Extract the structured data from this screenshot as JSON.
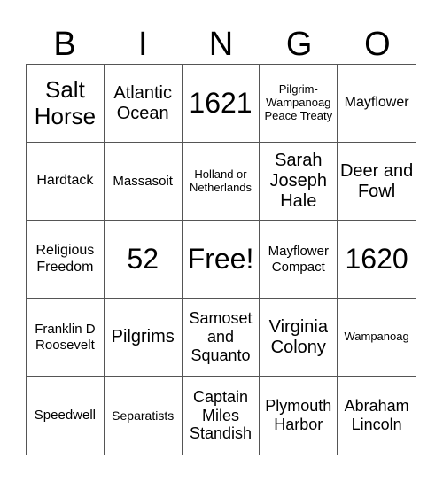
{
  "header": [
    "B",
    "I",
    "N",
    "G",
    "O"
  ],
  "cells": [
    {
      "text": "Salt Horse",
      "size": "s26"
    },
    {
      "text": "Atlantic Ocean",
      "size": "s20"
    },
    {
      "text": "1621",
      "size": "s32"
    },
    {
      "text": "Pilgrim-Wampanoag Peace Treaty",
      "size": "s13"
    },
    {
      "text": "Mayflower",
      "size": "s16"
    },
    {
      "text": "Hardtack",
      "size": "s16"
    },
    {
      "text": "Massasoit",
      "size": "s15"
    },
    {
      "text": "Holland or Netherlands",
      "size": "s13"
    },
    {
      "text": "Sarah Joseph Hale",
      "size": "s20"
    },
    {
      "text": "Deer and Fowl",
      "size": "s20"
    },
    {
      "text": "Religious Freedom",
      "size": "s16"
    },
    {
      "text": "52",
      "size": "s32"
    },
    {
      "text": "Free!",
      "size": "s32"
    },
    {
      "text": "Mayflower Compact",
      "size": "s15"
    },
    {
      "text": "1620",
      "size": "s32"
    },
    {
      "text": "Franklin D Roosevelt",
      "size": "s15"
    },
    {
      "text": "Pilgrims",
      "size": "s20"
    },
    {
      "text": "Samoset and Squanto",
      "size": "s18"
    },
    {
      "text": "Virginia Colony",
      "size": "s20"
    },
    {
      "text": "Wampanoag",
      "size": "s13"
    },
    {
      "text": "Speedwell",
      "size": "s15"
    },
    {
      "text": "Separatists",
      "size": "s14"
    },
    {
      "text": "Captain Miles Standish",
      "size": "s18"
    },
    {
      "text": "Plymouth Harbor",
      "size": "s18"
    },
    {
      "text": "Abraham Lincoln",
      "size": "s18"
    }
  ]
}
